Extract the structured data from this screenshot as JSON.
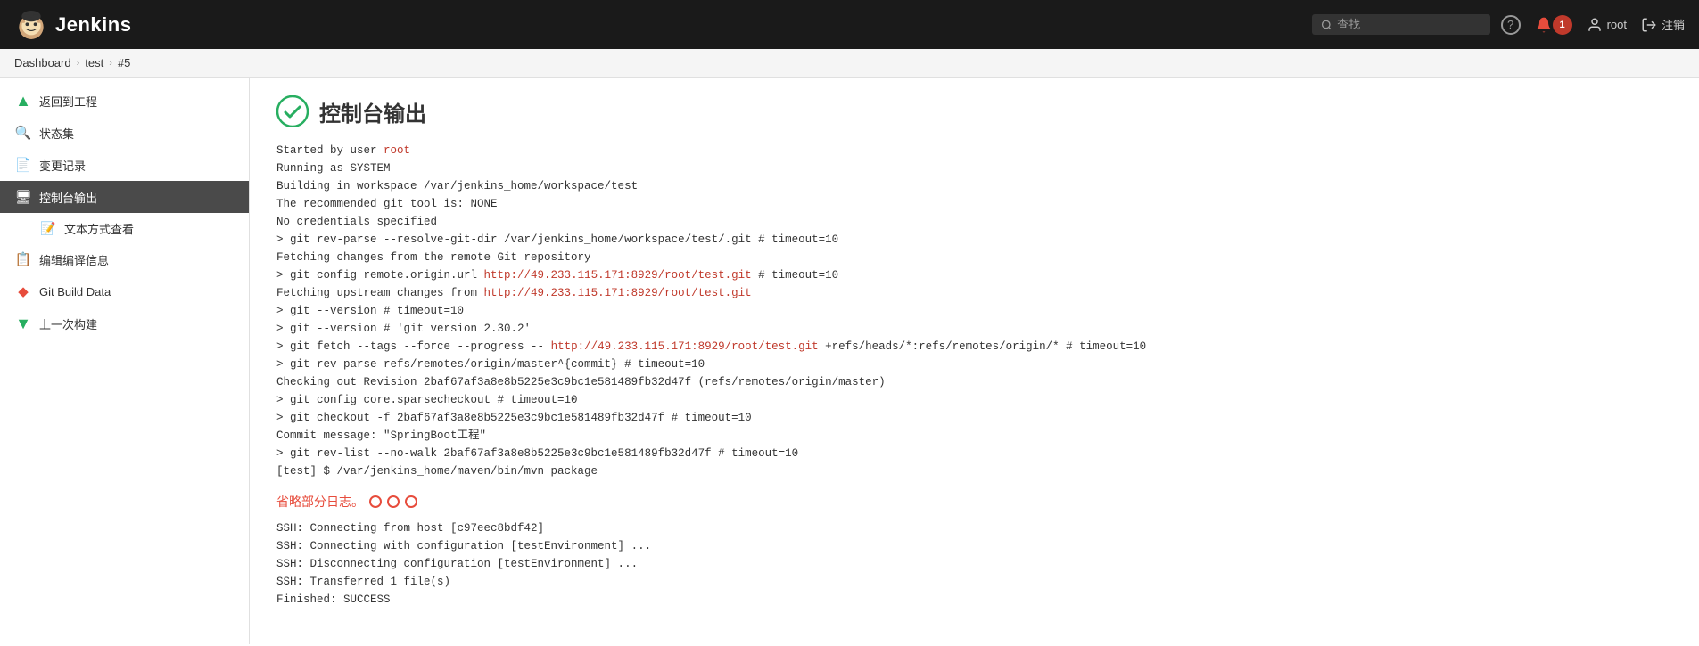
{
  "header": {
    "title": "Jenkins",
    "search_placeholder": "查找",
    "help_symbol": "?",
    "notif_count": "1",
    "user_label": "root",
    "logout_label": "注销"
  },
  "breadcrumb": {
    "items": [
      {
        "label": "Dashboard",
        "href": "#"
      },
      {
        "label": "test",
        "href": "#"
      },
      {
        "label": "#5",
        "href": "#"
      }
    ]
  },
  "sidebar": {
    "items": [
      {
        "id": "back-to-project",
        "label": "返回到工程",
        "icon": "⬆",
        "active": false,
        "indent": false
      },
      {
        "id": "status-collection",
        "label": "状态集",
        "icon": "🔍",
        "active": false,
        "indent": false
      },
      {
        "id": "change-log",
        "label": "变更记录",
        "icon": "📄",
        "active": false,
        "indent": false
      },
      {
        "id": "console-output",
        "label": "控制台输出",
        "icon": "🖥",
        "active": true,
        "indent": false
      },
      {
        "id": "text-view",
        "label": "文本方式查看",
        "icon": "📝",
        "active": false,
        "indent": true
      },
      {
        "id": "edit-annotation",
        "label": "编辑编译信息",
        "icon": "📋",
        "active": false,
        "indent": false
      },
      {
        "id": "git-build-data",
        "label": "Git Build Data",
        "icon": "♦",
        "active": false,
        "indent": false,
        "icon_color": "#e74c3c"
      },
      {
        "id": "prev-build",
        "label": "上一次构建",
        "icon": "⬇",
        "active": false,
        "indent": false,
        "icon_color": "#27ae60"
      }
    ]
  },
  "console": {
    "title": "控制台输出",
    "lines": [
      "Started by user root",
      "Running as SYSTEM",
      "Building in workspace /var/jenkins_home/workspace/test",
      "The recommended git tool is: NONE",
      "No credentials specified",
      "  > git rev-parse --resolve-git-dir /var/jenkins_home/workspace/test/.git # timeout=10",
      "Fetching changes from the remote Git repository",
      "  > git config remote.origin.url http://49.233.115.171:8929/root/test.git # timeout=10",
      "Fetching upstream changes from http://49.233.115.171:8929/root/test.git",
      "  > git --version # timeout=10",
      "  > git --version # 'git version 2.30.2'",
      "  > git fetch --tags --force --progress -- http://49.233.115.171:8929/root/test.git +refs/heads/*:refs/remotes/origin/* # timeout=10",
      "  > git rev-parse refs/remotes/origin/master^{commit} # timeout=10",
      "Checking out Revision 2baf67af3a8e8b5225e3c9bc1e581489fb32d47f (refs/remotes/origin/master)",
      "  > git config core.sparsecheckout # timeout=10",
      "  > git checkout -f 2baf67af3a8e8b5225e3c9bc1e581489fb32d47f # timeout=10",
      "Commit message: \"SpringBoot工程\"",
      "  > git rev-list --no-walk 2baf67af3a8e8b5225e3c9bc1e581489fb32d47f # timeout=10",
      "[test] $ /var/jenkins_home/maven/bin/mvn package"
    ],
    "omit_label": "省略部分日志。",
    "bottom_lines": [
      "SSH: Connecting from host [c97eec8bdf42]",
      "SSH: Connecting with configuration [testEnvironment] ...",
      "SSH: Disconnecting configuration [testEnvironment] ...",
      "SSH: Transferred 1 file(s)",
      "Finished:  SUCCESS"
    ],
    "root_link": "root",
    "git_url_1": "http://49.233.115.171:8929/root/test.git",
    "git_url_2": "http://49.233.115.171:8929/root/test.git",
    "git_url_3": "http://49.233.115.171:8929/root/test.git"
  }
}
